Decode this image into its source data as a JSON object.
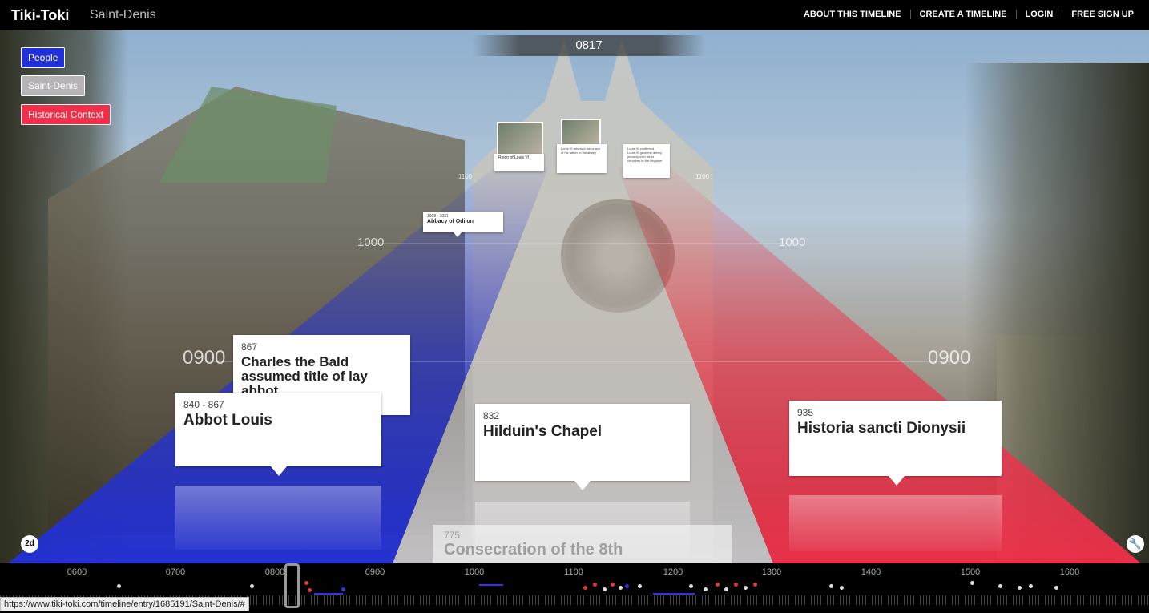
{
  "header": {
    "brand": "Tiki-Toki",
    "timeline_title": "Saint-Denis",
    "nav": [
      "ABOUT THIS TIMELINE",
      "CREATE A TIMELINE",
      "LOGIN",
      "FREE SIGN UP"
    ]
  },
  "current_year": "0817",
  "categories": [
    {
      "label": "People",
      "color": "#2230d8"
    },
    {
      "label": "Saint-Denis",
      "color": "#b5b3b6"
    },
    {
      "label": "Historical Context",
      "color": "#f0304a"
    }
  ],
  "grid_labels": {
    "y0900_left": "0900",
    "y0900_right": "0900",
    "y1000_left": "1000",
    "y1000_right": "1000",
    "y1100_left": "1100",
    "y1100_right": "1100"
  },
  "stories": {
    "abbot_louis": {
      "date": "840 - 867",
      "title": "Abbot Louis"
    },
    "charles_bald": {
      "date": "867",
      "title": "Charles the Bald assumed title of lay abbot"
    },
    "hilduin": {
      "date": "832",
      "title": "Hilduin's Chapel"
    },
    "historia": {
      "date": "935",
      "title": "Historia sancti Dionysii"
    },
    "odilon": {
      "date": "1008 - 1031",
      "title": "Abbacy of Odilon"
    },
    "consecration": {
      "date": "775",
      "title": "Consecration of the 8th"
    },
    "reign_louis": {
      "title": "Reign of Louis VI"
    },
    "louis_returned": {
      "text": "Louis VI returned the crown of his father to the abbey"
    },
    "louis_gave": {
      "title": "Louis VI confirmed",
      "text": "Louis VI gave the abbey primacy over other churches in the kingdom"
    }
  },
  "controls": {
    "view_toggle": "2d"
  },
  "navigator": {
    "years": [
      "0600",
      "0700",
      "0800",
      "0900",
      "1000",
      "1100",
      "1200",
      "1300",
      "1400",
      "1500",
      "1600"
    ]
  },
  "status_url": "https://www.tiki-toki.com/timeline/entry/1685191/Saint-Denis/#",
  "colors": {
    "blue": "#2230d8",
    "grey": "#b5b3b6",
    "red": "#f0304a"
  }
}
